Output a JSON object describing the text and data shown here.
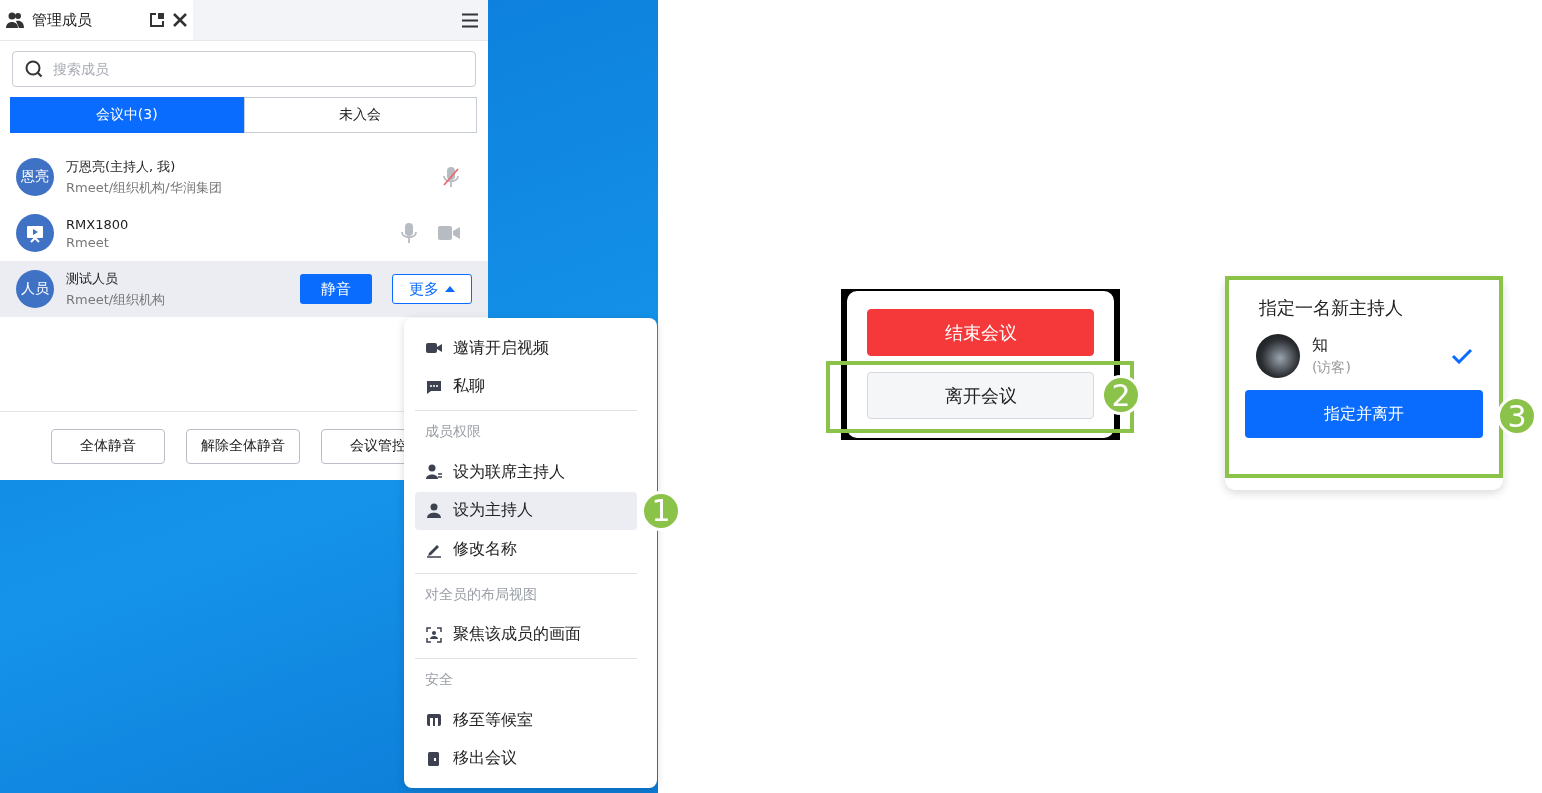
{
  "members_panel": {
    "tab_title": "管理成员",
    "search": {
      "placeholder": "搜索成员"
    },
    "tabs": [
      {
        "label": "会议中(3)",
        "selected": true
      },
      {
        "label": "未入会",
        "selected": false
      }
    ],
    "members": [
      {
        "kind": "muted",
        "avatar": "恩亮",
        "name": "万恩亮(主持人, 我)",
        "org": "Rmeet/组织机构/华润集团",
        "camera": false,
        "hovered": false
      },
      {
        "kind": "live",
        "name": "RMX1800",
        "org": "Rmeet",
        "camera": true,
        "hovered": false
      },
      {
        "kind": "actions",
        "avatar": "人员",
        "name": "测试人员",
        "org": "Rmeet/组织机构",
        "camera": false,
        "hovered": true,
        "mute_button": "静音",
        "more_button": "更多"
      }
    ],
    "footer_buttons": [
      "全体静音",
      "解除全体静音",
      "会议管控"
    ]
  },
  "context_menu": {
    "badge": "1",
    "items": [
      {
        "kind": "item",
        "label": "邀请开启视频",
        "highlighted": false
      },
      {
        "kind": "item",
        "label": "私聊",
        "highlighted": false
      },
      {
        "kind": "header",
        "label": "成员权限"
      },
      {
        "kind": "item",
        "label": "设为联席主持人",
        "highlighted": false
      },
      {
        "kind": "item",
        "label": "设为主持人",
        "highlighted": true
      },
      {
        "kind": "item",
        "label": "修改名称",
        "highlighted": false
      },
      {
        "kind": "header",
        "label": "对全员的布局视图"
      },
      {
        "kind": "item",
        "label": "聚焦该成员的画面",
        "highlighted": false
      },
      {
        "kind": "header",
        "label": "安全"
      },
      {
        "kind": "item",
        "label": "移至等候室",
        "highlighted": false
      },
      {
        "kind": "item",
        "label": "移出会议",
        "highlighted": false
      }
    ]
  },
  "end_dialog": {
    "badge": "2",
    "buttons": [
      {
        "kind": "danger",
        "label": "结束会议",
        "outlined": false
      },
      {
        "kind": "plain",
        "label": "离开会议",
        "outlined": true
      }
    ]
  },
  "assign_dialog": {
    "badge": "3",
    "title": "指定一名新主持人",
    "candidate": {
      "name": "知",
      "role": "(访客)",
      "selected": true
    },
    "button": "指定并离开"
  }
}
